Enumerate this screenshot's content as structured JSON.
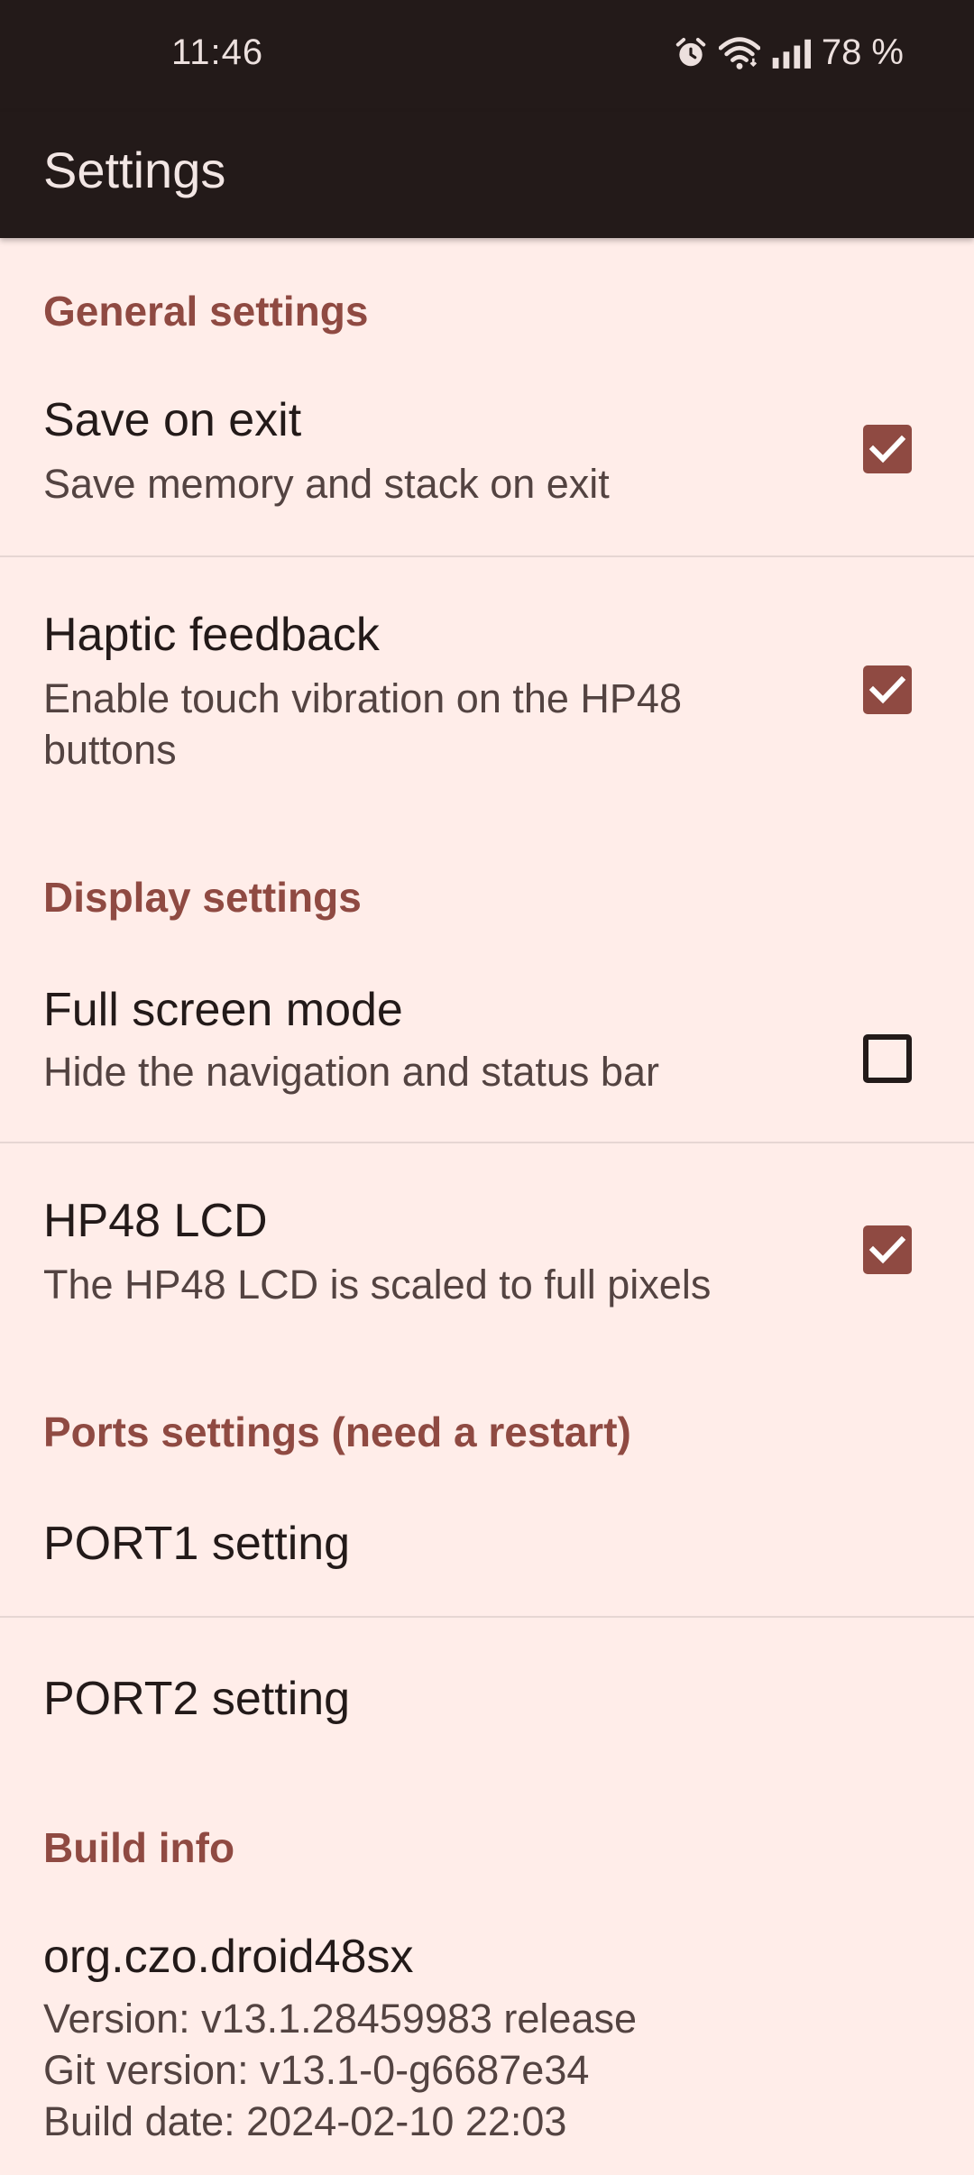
{
  "status_bar": {
    "time": "11:46",
    "battery": "78 %",
    "icons": [
      "alarm-icon",
      "wifi-icon",
      "signal-icon"
    ]
  },
  "app_bar": {
    "title": "Settings"
  },
  "sections": {
    "general": {
      "header": "General settings",
      "save_on_exit": {
        "title": "Save on exit",
        "summary": "Save memory and stack on exit",
        "checked": true
      },
      "haptic_feedback": {
        "title": "Haptic feedback",
        "summary": "Enable touch vibration on the HP48 buttons",
        "checked": true
      }
    },
    "display": {
      "header": "Display settings",
      "full_screen": {
        "title": "Full screen mode",
        "summary": "Hide the navigation and status bar",
        "checked": false
      },
      "hp48_lcd": {
        "title": "HP48 LCD",
        "summary": "The HP48 LCD is scaled to full pixels",
        "checked": true
      }
    },
    "ports": {
      "header": "Ports settings (need a restart)",
      "port1": {
        "title": "PORT1 setting"
      },
      "port2": {
        "title": "PORT2 setting"
      }
    },
    "build": {
      "header": "Build info",
      "package": "org.czo.droid48sx",
      "version": "Version: v13.1.28459983 release",
      "git_version": "Git version: v13.1-0-g6687e34",
      "build_date": "Build date: 2024-02-10 22:03"
    }
  },
  "colors": {
    "accent": "#8F4A42",
    "background": "#FFEDE9",
    "bar": "#231A19"
  }
}
